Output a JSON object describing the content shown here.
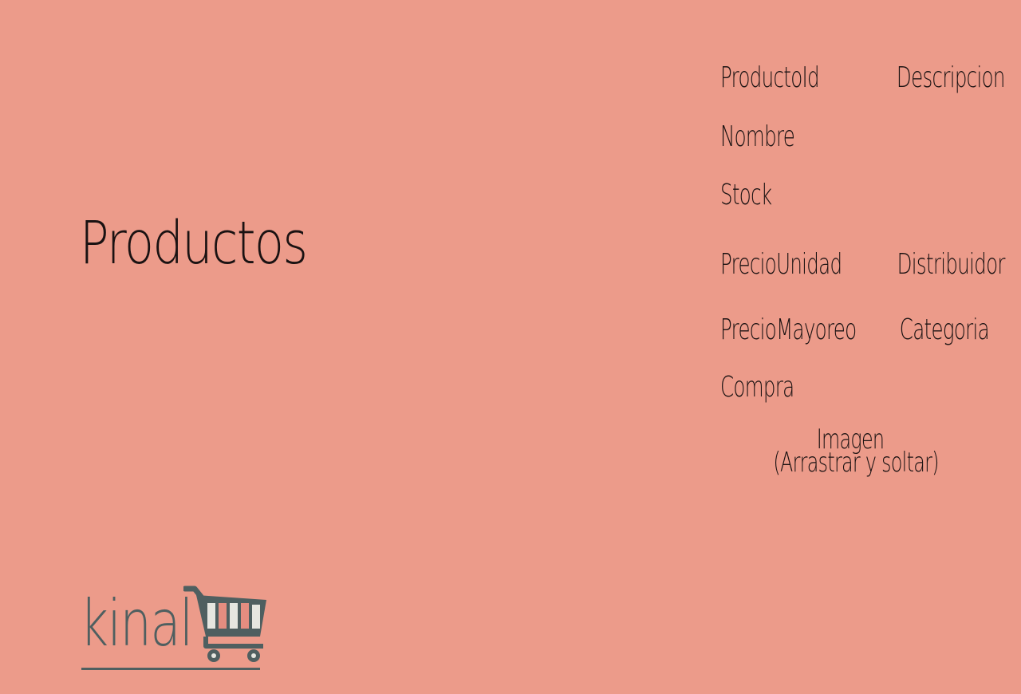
{
  "page": {
    "title": "Productos"
  },
  "form": {
    "fields": {
      "producto_id": "ProductoId",
      "descripcion": "Descripcion",
      "nombre": "Nombre",
      "stock": "Stock",
      "precio_unidad": "PrecioUnidad",
      "distribuidor": "Distribuidor",
      "precio_mayoreo": "PrecioMayoreo",
      "categoria": "Categoria",
      "compra": "Compra"
    },
    "image_drop": {
      "line1": "Imagen",
      "line2": "(Arrastrar y soltar)"
    }
  },
  "logo": {
    "text": "kinal",
    "icon": "shopping-cart-icon"
  },
  "colors": {
    "background": "#ec9b8a",
    "text": "#1a1212",
    "logo": "#4f5f60",
    "cart_stripe_light": "#e6e6e0",
    "cart_stripe_accent": "#e58d80"
  }
}
